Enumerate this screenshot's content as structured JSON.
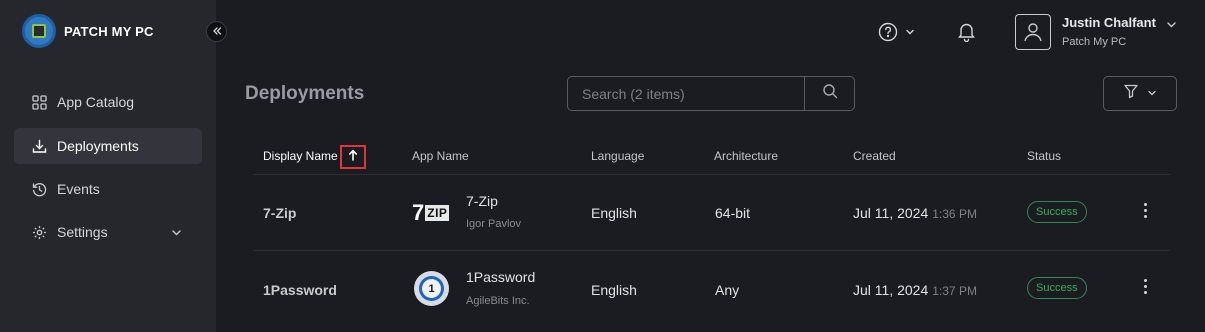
{
  "brand": {
    "name": "PATCH MY PC"
  },
  "sidebar": {
    "items": [
      {
        "label": "App Catalog",
        "icon": "grid-icon"
      },
      {
        "label": "Deployments",
        "icon": "download-icon",
        "active": true
      },
      {
        "label": "Events",
        "icon": "history-icon"
      },
      {
        "label": "Settings",
        "icon": "gear-icon"
      }
    ]
  },
  "header": {
    "user_name": "Justin Chalfant",
    "user_org": "Patch My PC"
  },
  "main": {
    "title": "Deployments",
    "search_placeholder": "Search (2 items)"
  },
  "table": {
    "columns": [
      "Display Name",
      "App Name",
      "Language",
      "Architecture",
      "Created",
      "Status"
    ],
    "rows": [
      {
        "display_name": "7-Zip",
        "app_name": "7-Zip",
        "publisher": "Igor Pavlov",
        "language": "English",
        "architecture": "64-bit",
        "created_date": "Jul 11, 2024",
        "created_time": "1:36 PM",
        "status": "Success"
      },
      {
        "display_name": "1Password",
        "app_name": "1Password",
        "publisher": "AgileBits Inc.",
        "language": "English",
        "architecture": "Any",
        "created_date": "Jul 11, 2024",
        "created_time": "1:37 PM",
        "status": "Success"
      }
    ]
  },
  "colors": {
    "background": "#1b1c21",
    "sidebar": "#26272d",
    "success": "#35b05a",
    "sort_highlight": "#e0353a"
  }
}
